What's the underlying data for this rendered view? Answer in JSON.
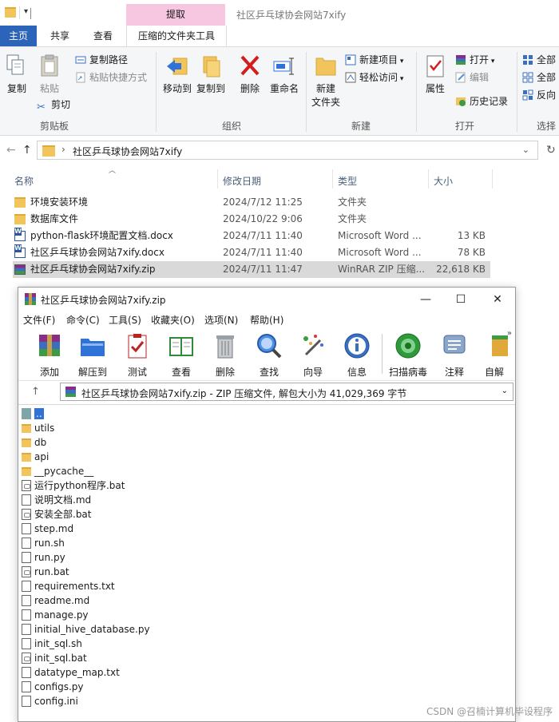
{
  "explorer": {
    "title": "社区乒乓球协会网站7xify",
    "context_tab_header": "提取",
    "tabs": [
      "主页",
      "共享",
      "查看",
      "压缩的文件夹工具"
    ],
    "ribbon": {
      "clipboard": {
        "label": "剪贴板",
        "copy": "复制",
        "paste": "粘贴",
        "copy_path": "复制路径",
        "paste_shortcut": "粘贴快捷方式",
        "cut": "剪切"
      },
      "organize": {
        "label": "组织",
        "move_to": "移动到",
        "copy_to": "复制到",
        "delete": "删除",
        "rename": "重命名"
      },
      "new": {
        "label": "新建",
        "new_folder_line1": "新建",
        "new_folder_line2": "文件夹",
        "new_item": "新建项目",
        "easy_access": "轻松访问"
      },
      "open": {
        "label": "打开",
        "properties": "属性",
        "open": "打开",
        "edit": "编辑",
        "history": "历史记录"
      },
      "select": {
        "label": "选择",
        "select_all": "全部",
        "select_none": "全部",
        "invert": "反向"
      }
    },
    "address": {
      "path": "社区乒乓球协会网站7xify"
    },
    "columns": {
      "name": "名称",
      "date": "修改日期",
      "type": "类型",
      "size": "大小"
    },
    "files": [
      {
        "icon": "folder-icon",
        "name": "环境安装环境",
        "date": "2024/7/12 11:25",
        "type": "文件夹",
        "size": ""
      },
      {
        "icon": "folder-icon",
        "name": "数据库文件",
        "date": "2024/10/22 9:06",
        "type": "文件夹",
        "size": ""
      },
      {
        "icon": "word-icon",
        "name": "python-flask环境配置文档.docx",
        "date": "2024/7/11 11:40",
        "type": "Microsoft Word ...",
        "size": "13 KB"
      },
      {
        "icon": "word-icon",
        "name": "社区乒乓球协会网站7xify.docx",
        "date": "2024/7/11 11:40",
        "type": "Microsoft Word ...",
        "size": "78 KB"
      },
      {
        "icon": "winrar-icon",
        "name": "社区乒乓球协会网站7xify.zip",
        "date": "2024/7/11 11:47",
        "type": "WinRAR ZIP 压缩...",
        "size": "22,618 KB"
      }
    ]
  },
  "winrar": {
    "title": "社区乒乓球协会网站7xify.zip",
    "window_controls": [
      "—",
      "☐",
      "✕"
    ],
    "menu": [
      "文件(F)",
      "命令(C)",
      "工具(S)",
      "收藏夹(O)",
      "选项(N)",
      "帮助(H)"
    ],
    "toolbar": [
      "添加",
      "解压到",
      "测试",
      "查看",
      "删除",
      "查找",
      "向导",
      "信息",
      "扫描病毒",
      "注释",
      "自解"
    ],
    "path_text": "社区乒乓球协会网站7xify.zip - ZIP 压缩文件, 解包大小为 41,029,369 字节",
    "entries": [
      {
        "kind": "up",
        "name": ".."
      },
      {
        "kind": "folder",
        "name": "utils"
      },
      {
        "kind": "folder",
        "name": "db"
      },
      {
        "kind": "folder",
        "name": "api"
      },
      {
        "kind": "folder",
        "name": "__pycache__"
      },
      {
        "kind": "bat",
        "name": "运行python程序.bat"
      },
      {
        "kind": "file",
        "name": "说明文档.md"
      },
      {
        "kind": "bat",
        "name": "安装全部.bat"
      },
      {
        "kind": "file",
        "name": "step.md"
      },
      {
        "kind": "file",
        "name": "run.sh"
      },
      {
        "kind": "file",
        "name": "run.py"
      },
      {
        "kind": "bat",
        "name": "run.bat"
      },
      {
        "kind": "file",
        "name": "requirements.txt"
      },
      {
        "kind": "file",
        "name": "readme.md"
      },
      {
        "kind": "file",
        "name": "manage.py"
      },
      {
        "kind": "file",
        "name": "initial_hive_database.py"
      },
      {
        "kind": "file",
        "name": "init_sql.sh"
      },
      {
        "kind": "bat",
        "name": "init_sql.bat"
      },
      {
        "kind": "file",
        "name": "datatype_map.txt"
      },
      {
        "kind": "file",
        "name": "configs.py"
      },
      {
        "kind": "file",
        "name": "config.ini"
      }
    ]
  },
  "watermark": "CSDN @召楠计算机毕设程序"
}
